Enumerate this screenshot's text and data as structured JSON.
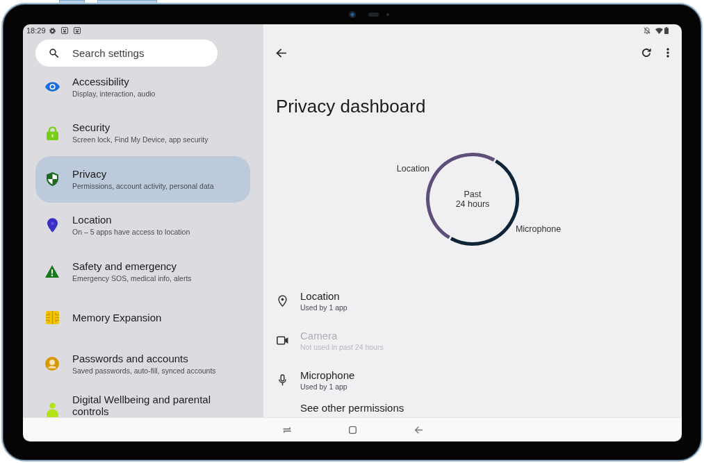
{
  "status_bar": {
    "time": "18:29"
  },
  "search": {
    "placeholder": "Search settings"
  },
  "sidebar": {
    "items": [
      {
        "title": "Accessibility",
        "subtitle": "Display, interaction, audio",
        "selected": false
      },
      {
        "title": "Security",
        "subtitle": "Screen lock, Find My Device, app security",
        "selected": false
      },
      {
        "title": "Privacy",
        "subtitle": "Permissions, account activity, personal data",
        "selected": true
      },
      {
        "title": "Location",
        "subtitle": "On – 5 apps have access to location",
        "selected": false
      },
      {
        "title": "Safety and emergency",
        "subtitle": "Emergency SOS, medical info, alerts",
        "selected": false
      },
      {
        "title": "Memory Expansion",
        "selected": false
      },
      {
        "title": "Passwords and accounts",
        "subtitle": "Saved passwords, auto-fill, synced accounts",
        "selected": false
      },
      {
        "title": "Digital Wellbeing and parental controls",
        "selected": false
      }
    ]
  },
  "dashboard": {
    "title": "Privacy dashboard",
    "chart": {
      "center_label": "Past\n24 hours",
      "segments": [
        {
          "label": "Location",
          "color": "#5e4f7a"
        },
        {
          "label": "Microphone",
          "color": "#0e2539"
        }
      ]
    },
    "permissions": [
      {
        "name": "Location",
        "usage": "Used by 1 app",
        "disabled": false
      },
      {
        "name": "Camera",
        "usage": "Not used in past 24 hours",
        "disabled": true
      },
      {
        "name": "Microphone",
        "usage": "Used by 1 app",
        "disabled": false
      }
    ],
    "more_link": "See other permissions"
  }
}
